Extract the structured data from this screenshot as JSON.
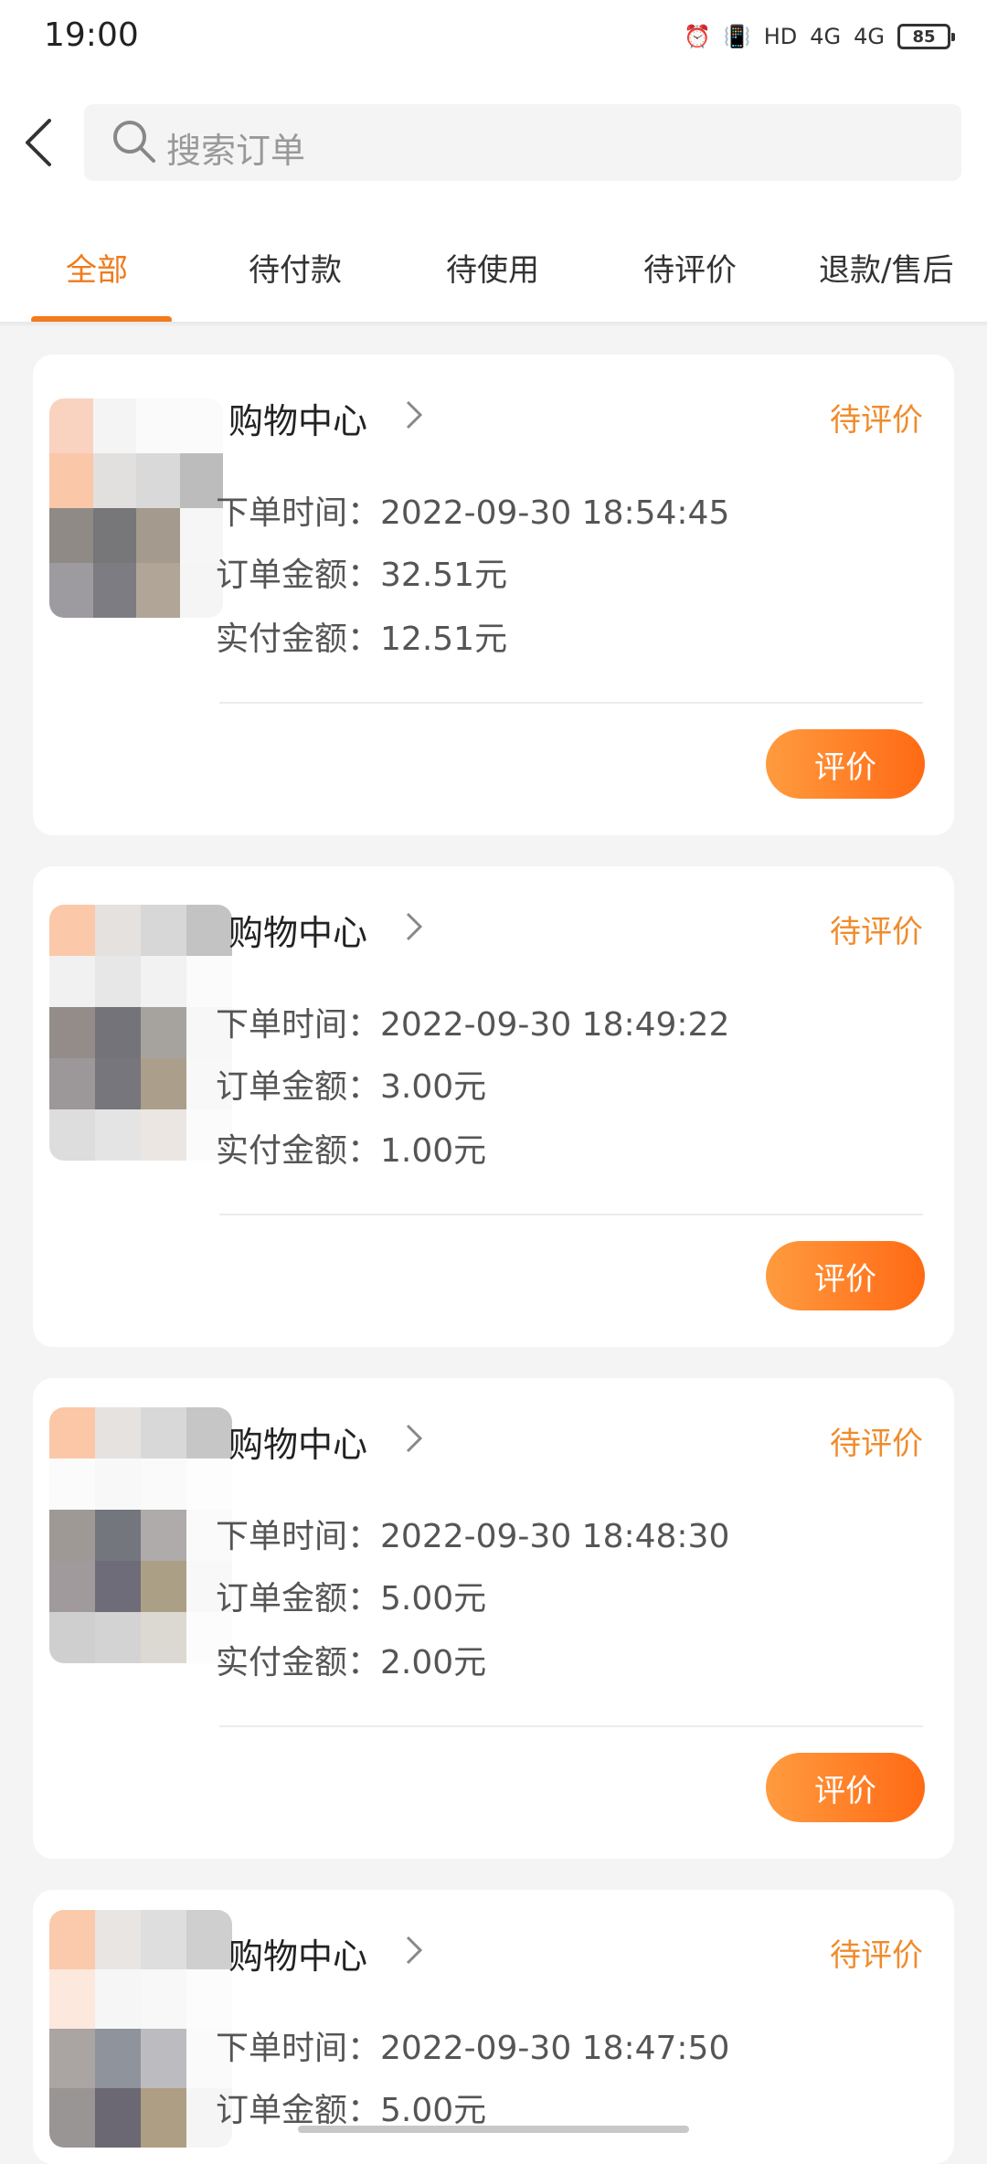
{
  "status_bar": {
    "time": "19:00",
    "icons": [
      "alarm-icon",
      "vibrate-icon",
      "hd-icon",
      "4g-icon",
      "4g-icon"
    ],
    "hd": "HD",
    "sig1": "4G",
    "sig2": "4G",
    "battery": "85"
  },
  "search": {
    "placeholder": "搜索订单"
  },
  "tabs": [
    "全部",
    "待付款",
    "待使用",
    "待评价",
    "退款/售后"
  ],
  "active_tab": 0,
  "accent_color": "#f47a1b",
  "orders": [
    {
      "shop": "购物中心",
      "status": "待评价",
      "time_label": "下单时间：",
      "time": "2022-09-30 18:54:45",
      "amount_label": "订单金额：",
      "amount": "32.51元",
      "paid_label": "实付金额：",
      "paid": "12.51元",
      "button": "评价"
    },
    {
      "shop": "购物中心",
      "status": "待评价",
      "time_label": "下单时间：",
      "time": "2022-09-30 18:49:22",
      "amount_label": "订单金额：",
      "amount": "3.00元",
      "paid_label": "实付金额：",
      "paid": "1.00元",
      "button": "评价"
    },
    {
      "shop": "购物中心",
      "status": "待评价",
      "time_label": "下单时间：",
      "time": "2022-09-30 18:48:30",
      "amount_label": "订单金额：",
      "amount": "5.00元",
      "paid_label": "实付金额：",
      "paid": "2.00元",
      "button": "评价"
    },
    {
      "shop": "购物中心",
      "status": "待评价",
      "time_label": "下单时间：",
      "time": "2022-09-30 18:47:50",
      "amount_label": "订单金额：",
      "amount": "5.00元"
    }
  ]
}
